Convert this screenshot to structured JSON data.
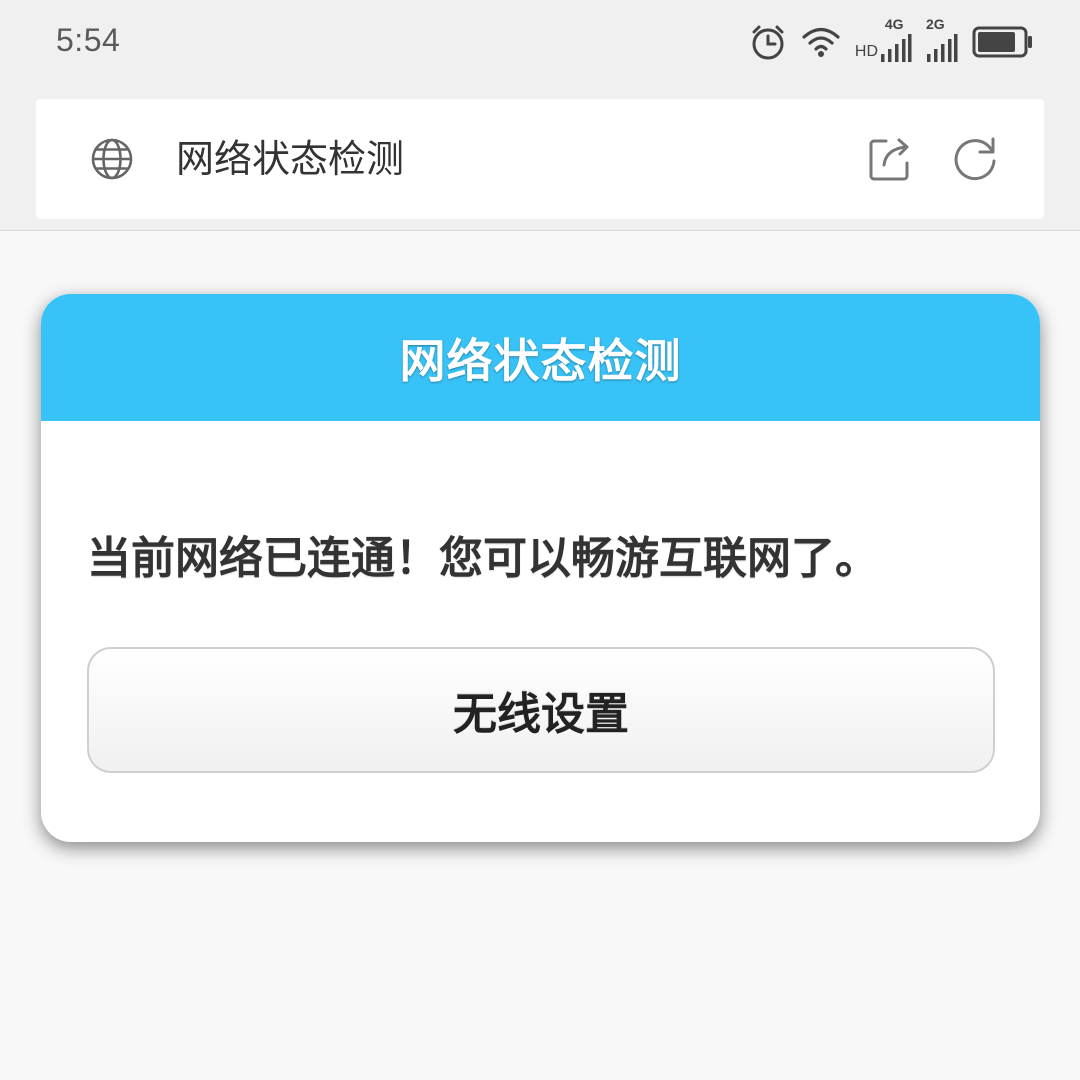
{
  "status_bar": {
    "time": "5:54",
    "hd_label": "HD",
    "network_1": "4G",
    "network_2": "2G",
    "icons": [
      "alarm-icon",
      "wifi-icon",
      "signal-icon",
      "signal-icon",
      "battery-icon"
    ],
    "battery_level": 0.85
  },
  "address_bar": {
    "page_title": "网络状态检测",
    "icons": [
      "globe-icon",
      "share-icon",
      "refresh-icon"
    ]
  },
  "dialog": {
    "title": "网络状态检测",
    "message": "当前网络已连通！您可以畅游互联网了。",
    "button_label": "无线设置"
  },
  "colors": {
    "header_bg": "#38c3f8",
    "page_bg": "#f8f8f8",
    "toolbar_bg": "#f0f0f0"
  }
}
